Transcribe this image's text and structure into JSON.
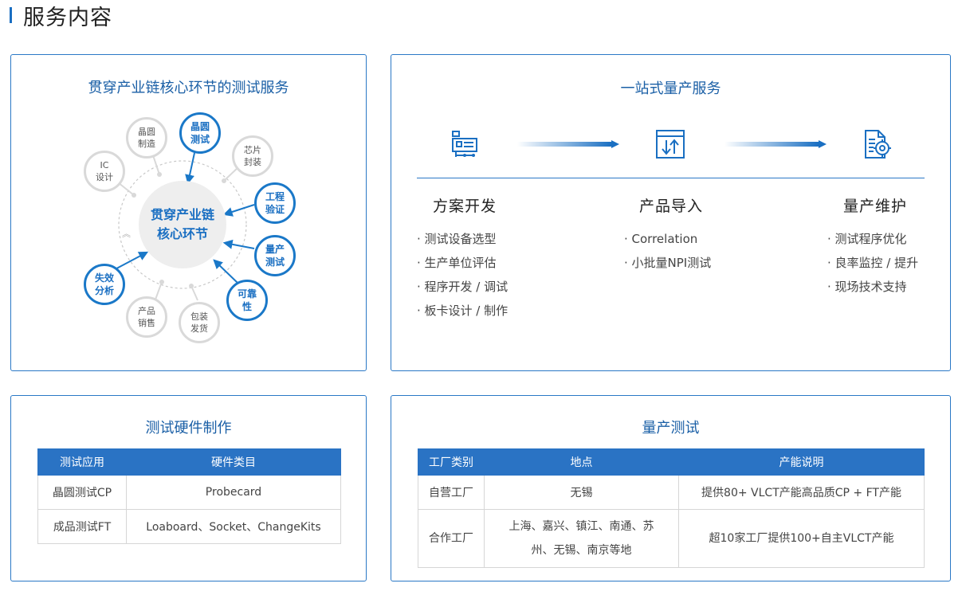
{
  "page": {
    "title": "服务内容",
    "accent_color": "#1a6fc2"
  },
  "chain_card": {
    "title": "贯穿产业链核心环节的测试服务",
    "center_line1": "贯穿产业链",
    "center_line2": "核心环节",
    "gray_nodes": [
      {
        "line1": "晶圆",
        "line2": "制造"
      },
      {
        "line1": "IC",
        "line2": "设计"
      },
      {
        "line1": "芯片",
        "line2": "封装"
      },
      {
        "line1": "产品",
        "line2": "销售"
      },
      {
        "line1": "包装",
        "line2": "发货"
      }
    ],
    "blue_nodes": [
      {
        "line1": "晶圆",
        "line2": "测试"
      },
      {
        "line1": "工程",
        "line2": "验证"
      },
      {
        "line1": "量产",
        "line2": "测试"
      },
      {
        "line1": "可靠",
        "line2": "性"
      },
      {
        "line1": "失效",
        "line2": "分析"
      }
    ]
  },
  "onestop_card": {
    "title": "一站式量产服务",
    "icons": [
      "flowchart-icon",
      "import-icon",
      "document-gear-icon"
    ],
    "columns": [
      {
        "title": "方案开发",
        "items": [
          "· 测试设备选型",
          "· 生产单位评估",
          "· 程序开发 / 调试",
          "· 板卡设计 / 制作"
        ]
      },
      {
        "title": "产品导入",
        "items": [
          "· Correlation",
          "· 小批量NPI测试"
        ]
      },
      {
        "title": "量产维护",
        "items": [
          "· 测试程序优化",
          "· 良率监控 / 提升",
          "· 现场技术支持"
        ]
      }
    ]
  },
  "hardware_card": {
    "title": "测试硬件制作",
    "headers": [
      "测试应用",
      "硬件类目"
    ],
    "rows": [
      [
        "晶圆测试CP",
        "Probecard"
      ],
      [
        "成品测试FT",
        "Loaboard、Socket、ChangeKits"
      ]
    ]
  },
  "mass_card": {
    "title": "量产测试",
    "headers": [
      "工厂类别",
      "地点",
      "产能说明"
    ],
    "rows": [
      {
        "type": "自营工厂",
        "place_line1": "无锡",
        "place_line2": "",
        "capacity": "提供80+ VLCT产能高品质CP + FT产能"
      },
      {
        "type": "合作工厂",
        "place_line1": "上海、嘉兴、镇江、南通、苏",
        "place_line2": "州、无锡、南京等地",
        "capacity": "超10家工厂提供100+自主VLCT产能"
      }
    ]
  }
}
